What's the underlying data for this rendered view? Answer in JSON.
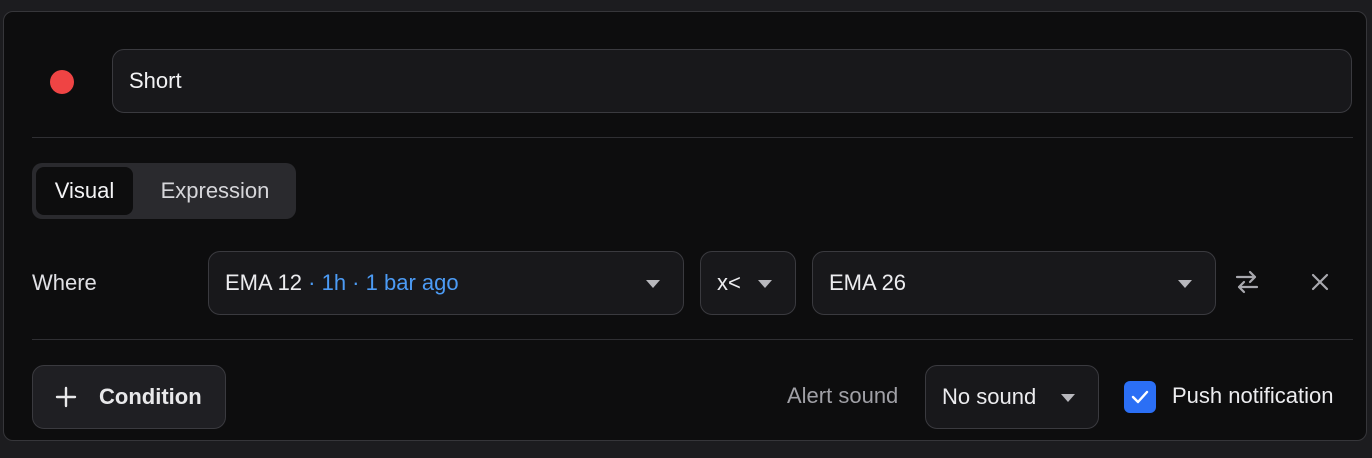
{
  "condition": {
    "color": "#ef4444",
    "name": "Short"
  },
  "mode_toggle": {
    "options": [
      "Visual",
      "Expression"
    ],
    "selected": "Visual"
  },
  "rule": {
    "where_label": "Where",
    "left_operand": {
      "indicator": "EMA 12",
      "timeframe": " · 1h · ",
      "offset": "1 bar ago"
    },
    "operator": "x<",
    "right_operand": "EMA 26",
    "icons": [
      "swap-icon",
      "close-icon"
    ]
  },
  "footer": {
    "add_condition_label": "Condition",
    "alert_sound_label": "Alert sound",
    "alert_sound_value": "No sound",
    "push_notification_label": "Push notification",
    "push_notification_checked": true,
    "accent_color": "#2b6ff5"
  }
}
